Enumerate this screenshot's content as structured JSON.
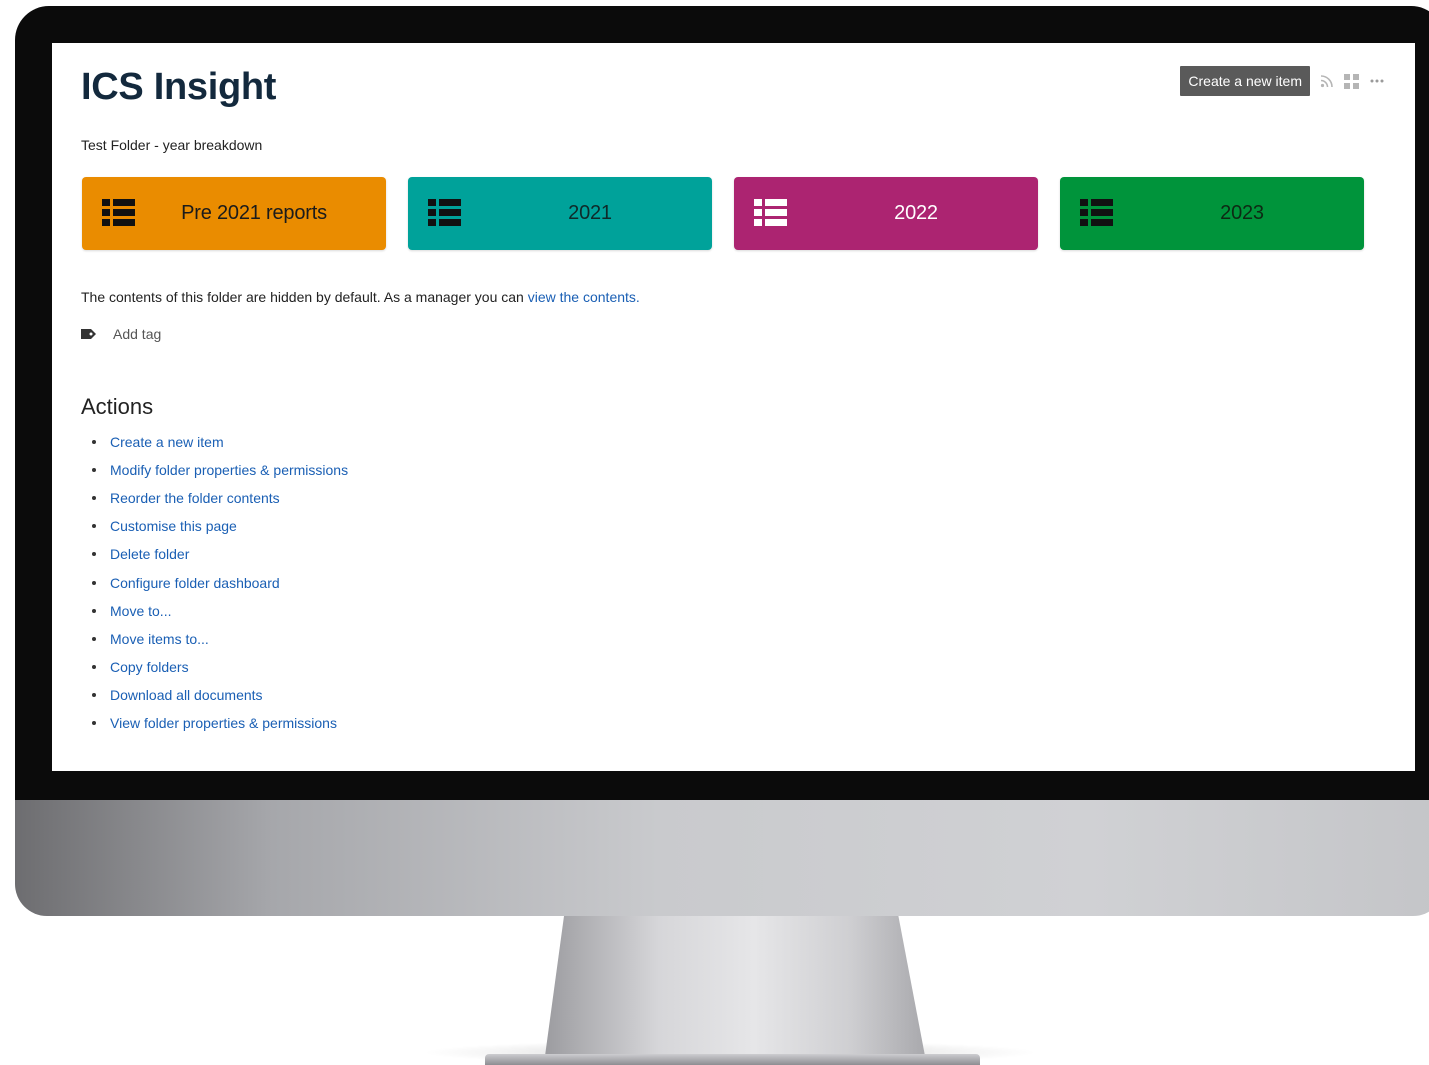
{
  "page": {
    "title": "ICS Insight",
    "subtitle": "Test Folder - year breakdown"
  },
  "toolbar": {
    "create_label": "Create a new item",
    "icons": [
      "rss-icon",
      "grid-view-icon",
      "more-icon"
    ]
  },
  "tiles": [
    {
      "label": "Pre 2021 reports",
      "color": "#ea8c00",
      "icon": "list-icon"
    },
    {
      "label": "2021",
      "color": "#00a29a",
      "icon": "list-icon"
    },
    {
      "label": "2022",
      "color": "#ac2471",
      "icon": "list-icon"
    },
    {
      "label": "2023",
      "color": "#00943b",
      "icon": "list-icon"
    }
  ],
  "notice": {
    "text": "The contents of this folder are hidden by default. As a manager you can ",
    "link": "view the contents."
  },
  "tag": {
    "label": "Add tag",
    "icon": "tag-icon"
  },
  "actions": {
    "heading": "Actions",
    "items": [
      "Create a new item",
      "Modify folder properties & permissions",
      "Reorder the folder contents",
      "Customise this page",
      "Delete folder",
      "Configure folder dashboard",
      "Move to...",
      "Move items to...",
      "Copy folders",
      "Download all documents",
      "View folder properties & permissions"
    ]
  },
  "colors": {
    "link": "#1a5fb4",
    "title": "#13293d",
    "button": "#5a5a5a"
  }
}
